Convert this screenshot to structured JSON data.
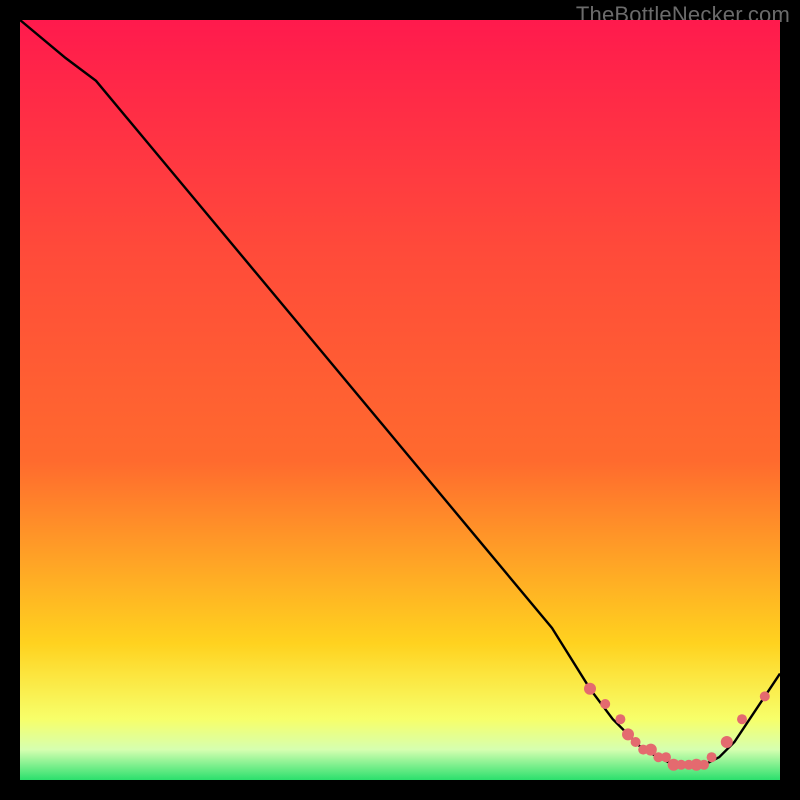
{
  "watermark": "TheBottleNecker.com",
  "colors": {
    "bg": "#000000",
    "gradient_top": "#ff1a4d",
    "gradient_upper": "#ff6a2e",
    "gradient_mid": "#ffd21f",
    "gradient_lower": "#f7ff6a",
    "gradient_green": "#2be06d",
    "line": "#000000",
    "marker": "#e46a6f"
  },
  "chart_data": {
    "type": "line",
    "title": "",
    "xlabel": "",
    "ylabel": "",
    "xlim": [
      0,
      100
    ],
    "ylim": [
      0,
      100
    ],
    "legend": false,
    "grid": false,
    "series": [
      {
        "name": "curve",
        "x": [
          0,
          6,
          10,
          20,
          30,
          40,
          50,
          60,
          70,
          75,
          78,
          80,
          82,
          84,
          86,
          88,
          90,
          92,
          94,
          96,
          98,
          100
        ],
        "y": [
          100,
          95,
          92,
          80,
          68,
          56,
          44,
          32,
          20,
          12,
          8,
          6,
          4,
          3,
          2,
          2,
          2,
          3,
          5,
          8,
          11,
          14
        ]
      }
    ],
    "markers": {
      "name": "dots",
      "x": [
        75,
        77,
        79,
        80,
        81,
        82,
        83,
        84,
        85,
        86,
        87,
        88,
        89,
        90,
        91,
        93,
        95,
        98
      ],
      "y": [
        12,
        10,
        8,
        6,
        5,
        4,
        4,
        3,
        3,
        2,
        2,
        2,
        2,
        2,
        3,
        5,
        8,
        11
      ]
    }
  }
}
